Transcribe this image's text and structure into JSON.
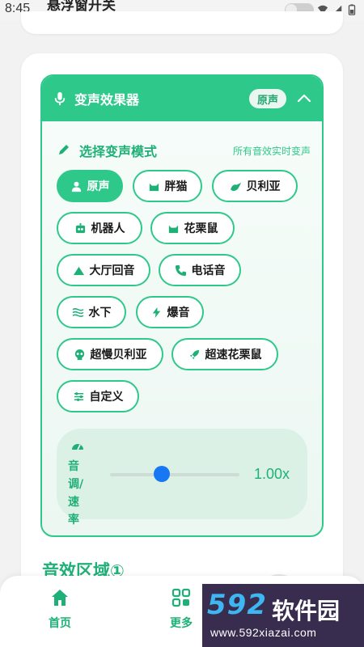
{
  "status_bar": {
    "time": "8:45",
    "overlay_title": "悬浮窗开关"
  },
  "panel": {
    "title": "变声效果器",
    "current_mode_badge": "原声",
    "section_label": "选择变声模式",
    "section_hint": "所有音效实时变声"
  },
  "modes": [
    {
      "label": "原声",
      "icon": "person-icon",
      "active": true
    },
    {
      "label": "胖猫",
      "icon": "cat-icon",
      "active": false
    },
    {
      "label": "贝利亚",
      "icon": "dragon-icon",
      "active": false
    },
    {
      "label": "机器人",
      "icon": "robot-icon",
      "active": false
    },
    {
      "label": "花栗鼠",
      "icon": "squirrel-icon",
      "active": false
    },
    {
      "label": "大厅回音",
      "icon": "mountain-icon",
      "active": false
    },
    {
      "label": "电话音",
      "icon": "phone-icon",
      "active": false
    },
    {
      "label": "水下",
      "icon": "water-icon",
      "active": false
    },
    {
      "label": "爆音",
      "icon": "bolt-icon",
      "active": false
    },
    {
      "label": "超慢贝利亚",
      "icon": "skull-icon",
      "active": false
    },
    {
      "label": "超速花栗鼠",
      "icon": "rocket-icon",
      "active": false
    },
    {
      "label": "自定义",
      "icon": "sliders-icon",
      "active": false
    }
  ],
  "pitch": {
    "label": "音调/速率",
    "value_text": "1.00x",
    "slider_fraction": 0.4
  },
  "sound_area_title": "音效区域①",
  "nav": {
    "home": "首页",
    "more": "更多"
  },
  "watermark": {
    "number": "592",
    "brand": "软件园",
    "url": "www.592xiazai.com"
  },
  "colors": {
    "accent": "#2ec98a",
    "accent_dark": "#1fb077",
    "slider_thumb": "#1877f2"
  }
}
